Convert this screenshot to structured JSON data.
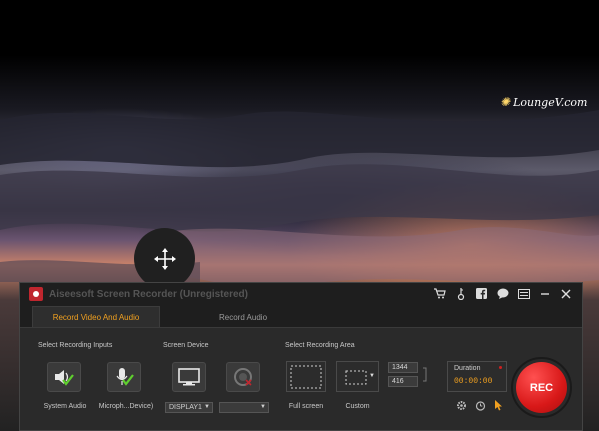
{
  "watermark": {
    "text": "LoungeV.com",
    "icon": "star-icon"
  },
  "window": {
    "title": "Aiseesoft Screen Recorder (Unregistered)",
    "titlebar_icons": [
      "cart-icon",
      "key-icon",
      "facebook-icon",
      "chat-icon",
      "menu-icon",
      "minimize-icon",
      "close-icon"
    ]
  },
  "tabs": [
    {
      "label": "Record Video And Audio",
      "active": true
    },
    {
      "label": "Record Audio",
      "active": false
    }
  ],
  "sections": {
    "inputs_label": "Select Recording Inputs",
    "device_label": "Screen Device",
    "area_label": "Select Recording Area"
  },
  "inputs": {
    "system_audio_label": "System Audio",
    "microphone_label": "Microph...Device)"
  },
  "device": {
    "display_value": "DISPLAY1",
    "camera_value": ""
  },
  "area": {
    "full_screen_label": "Full screen",
    "custom_label": "Custom",
    "width": "1344",
    "height": "416"
  },
  "duration": {
    "label": "Duration",
    "value": "00:00:00"
  },
  "rec": {
    "label": "REC"
  },
  "colors": {
    "accent": "#f0a020",
    "rec": "#d81818",
    "panel": "#2a2a2a"
  }
}
